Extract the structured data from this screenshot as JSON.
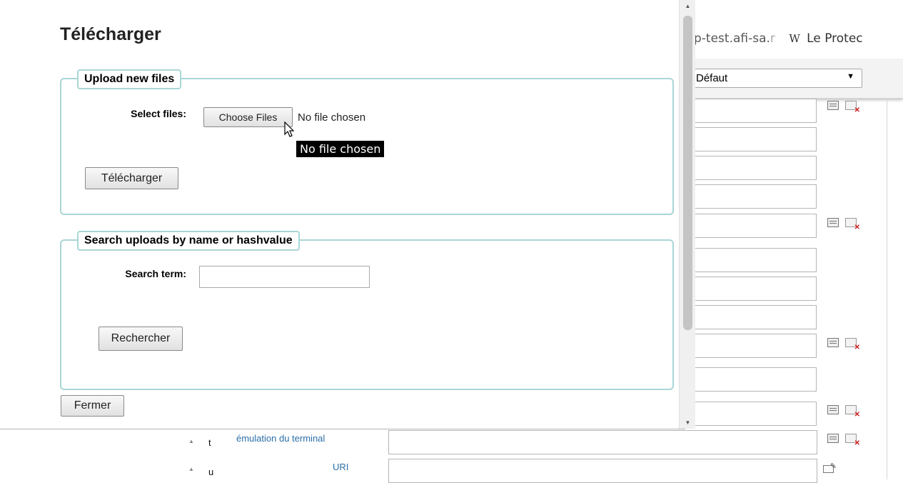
{
  "background": {
    "tabs": [
      {
        "label_main": "p-test.afi-sa.",
        "label_fade": "r"
      },
      {
        "icon": "wikipedia-icon",
        "icon_glyph": "W",
        "label": "Le Protec"
      }
    ],
    "select": {
      "value": "Défaut"
    },
    "rows": [
      {
        "letter": "t",
        "link": "émulation du terminal"
      },
      {
        "letter": "u",
        "link": "URI"
      }
    ]
  },
  "dialog": {
    "title": "Télécharger",
    "upload": {
      "legend": "Upload new files",
      "select_label": "Select files:",
      "choose_button": "Choose Files",
      "file_status": "No file chosen",
      "tooltip": "No file chosen",
      "submit_button": "Télécharger"
    },
    "search": {
      "legend": "Search uploads by name or hashvalue",
      "term_label": "Search term:",
      "term_value": "",
      "search_button": "Rechercher"
    },
    "close_button": "Fermer"
  },
  "colors": {
    "fieldset_border": "#a9d6d6",
    "link": "#2c6ea8",
    "tooltip_bg": "#000000"
  }
}
